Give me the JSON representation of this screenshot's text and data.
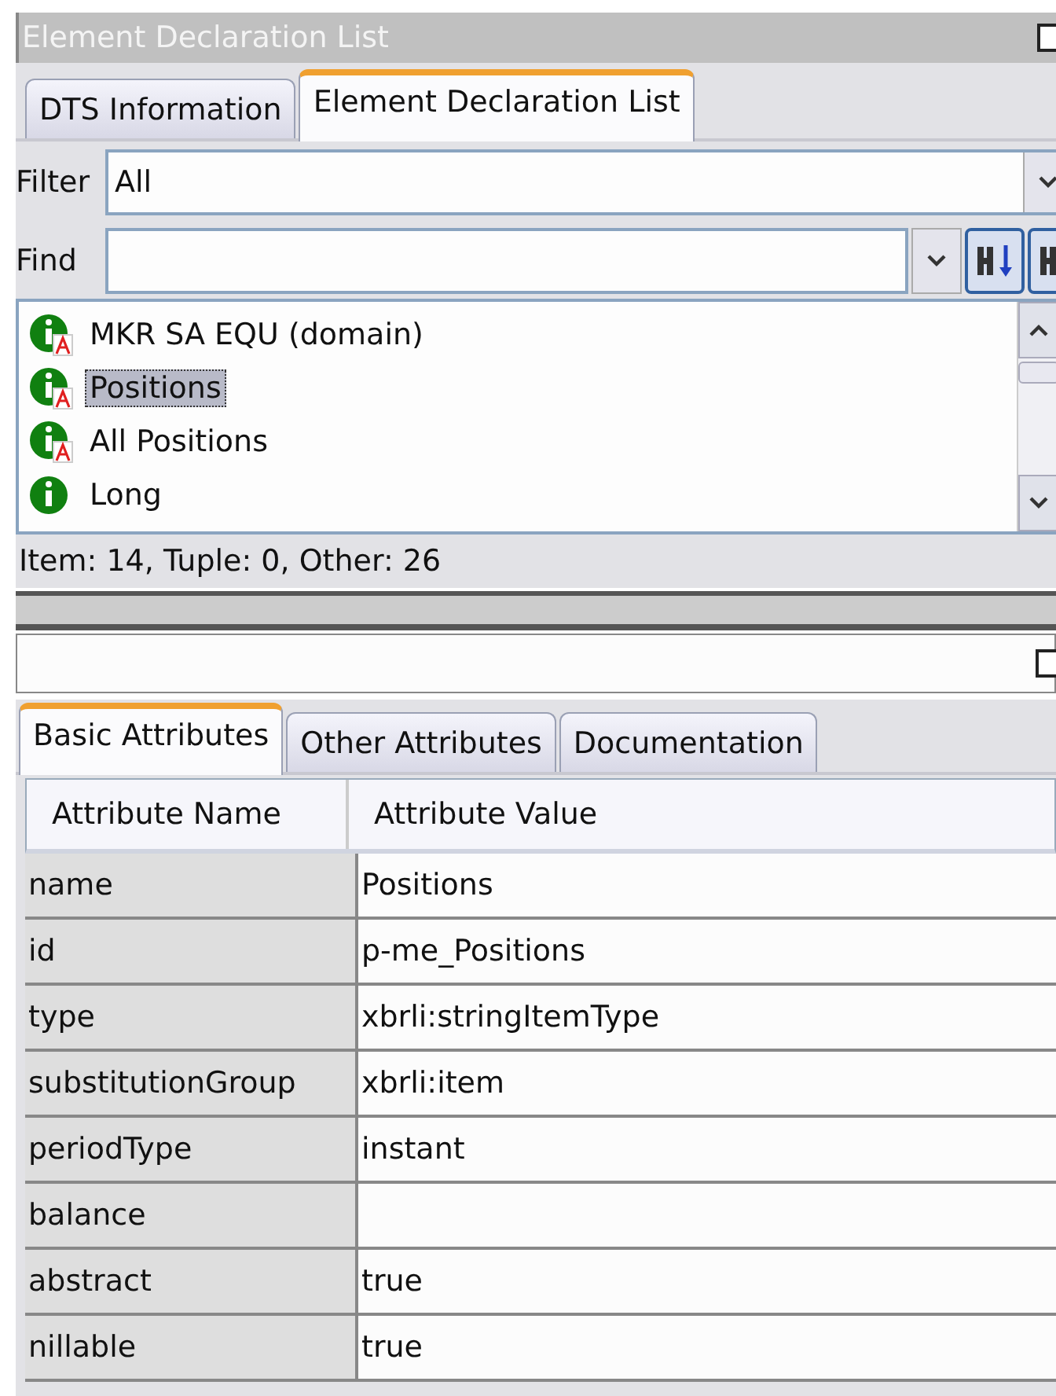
{
  "window": {
    "title": "Element Declaration List"
  },
  "tabs": [
    {
      "label": "DTS Information",
      "selected": false
    },
    {
      "label": "Element Declaration List",
      "selected": true
    }
  ],
  "filter": {
    "label": "Filter",
    "value": "All"
  },
  "find": {
    "label": "Find"
  },
  "elements": [
    {
      "name": "MKR SA EQU (domain)",
      "kind": "abstract",
      "selected": false
    },
    {
      "name": "Positions",
      "kind": "abstract",
      "selected": true
    },
    {
      "name": "All Positions",
      "kind": "abstract",
      "selected": false
    },
    {
      "name": "Long",
      "kind": "item",
      "selected": false
    }
  ],
  "status_bar": "Item: 14, Tuple: 0, Other: 26",
  "detail_tabs": [
    {
      "label": "Basic Attributes",
      "selected": true
    },
    {
      "label": "Other Attributes",
      "selected": false
    },
    {
      "label": "Documentation",
      "selected": false
    }
  ],
  "table": {
    "columns": [
      "Attribute Name",
      "Attribute Value"
    ],
    "rows": [
      [
        "name",
        "Positions"
      ],
      [
        "id",
        "p-me_Positions"
      ],
      [
        "type",
        "xbrli:stringItemType"
      ],
      [
        "substitutionGroup",
        "xbrli:item"
      ],
      [
        "periodType",
        "instant"
      ],
      [
        "balance",
        ""
      ],
      [
        "abstract",
        "true"
      ],
      [
        "nillable",
        "true"
      ]
    ]
  }
}
